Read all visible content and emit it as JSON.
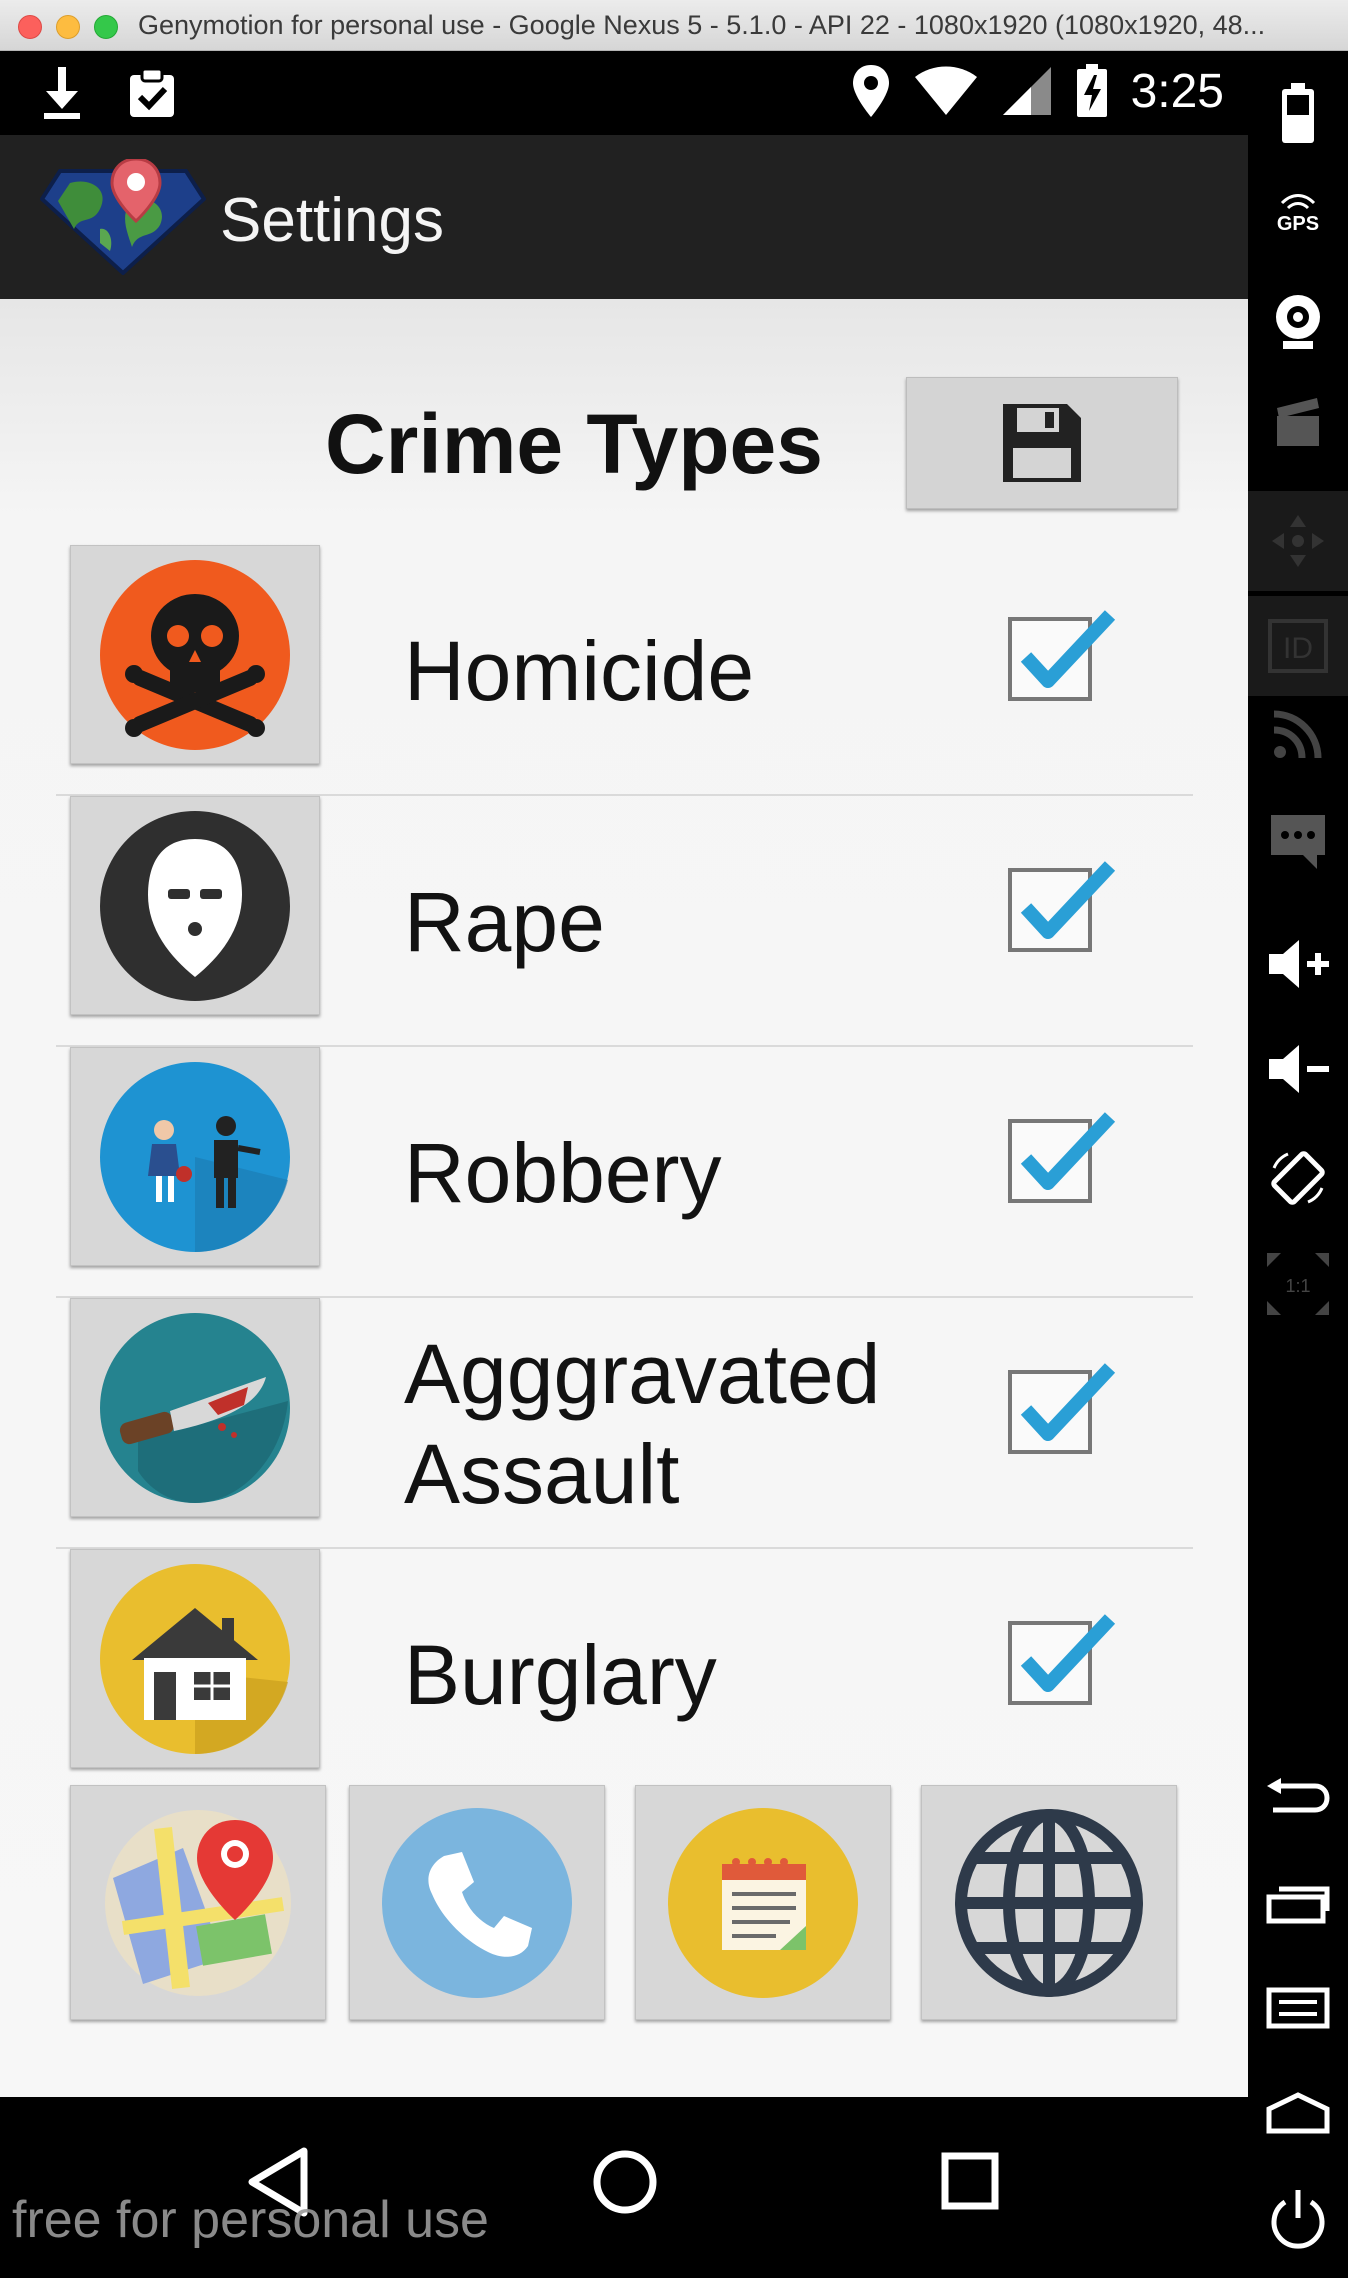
{
  "window": {
    "title": "Genymotion for personal use - Google Nexus 5 - 5.1.0 - API 22 - 1080x1920 (1080x1920, 48..."
  },
  "status_bar": {
    "time": "3:25",
    "icons_left": [
      "download-icon",
      "clipboard-check-icon"
    ],
    "icons_right": [
      "location-icon",
      "wifi-icon",
      "signal-icon",
      "battery-charging-icon"
    ]
  },
  "app_bar": {
    "title": "Settings",
    "logo": "crime-map-logo"
  },
  "main": {
    "heading": "Crime Types",
    "save_icon": "floppy-disk-icon",
    "crime_types": [
      {
        "label": "Homicide",
        "icon": "skull-crossbones-icon",
        "checked": true,
        "color": "#f05a1e"
      },
      {
        "label": "Rape",
        "icon": "masked-face-icon",
        "checked": true,
        "color": "#2f2f2f"
      },
      {
        "label": "Robbery",
        "icon": "robbery-icon",
        "checked": true,
        "color": "#1e93d2"
      },
      {
        "label": "Agggravated Assault",
        "icon": "bloody-knife-icon",
        "checked": true,
        "color": "#25838f"
      },
      {
        "label": "Burglary",
        "icon": "house-icon",
        "checked": true,
        "color": "#e9be2e"
      }
    ],
    "bottom_buttons": [
      {
        "name": "map-button",
        "icon": "map-pin-icon"
      },
      {
        "name": "phone-button",
        "icon": "phone-icon"
      },
      {
        "name": "notes-button",
        "icon": "notepad-icon"
      },
      {
        "name": "web-button",
        "icon": "globe-icon"
      }
    ]
  },
  "nav_bar": {
    "buttons": [
      "back-icon",
      "home-icon",
      "recents-icon"
    ]
  },
  "watermark": "free for personal use",
  "emulator_sidebar": {
    "tools": [
      "battery-icon",
      "gps-icon",
      "webcam-icon",
      "screencast-icon",
      "dpad-icon",
      "device-id-icon",
      "network-icon",
      "sms-icon",
      "volume-up-icon",
      "volume-down-icon",
      "rotate-icon",
      "scale-icon",
      "back-icon",
      "recent-apps-icon",
      "menu-icon",
      "home-icon",
      "power-icon"
    ],
    "gps_label": "GPS",
    "id_label": "ID",
    "scale_label": "1:1"
  },
  "colors": {
    "check_blue": "#2a9fd6",
    "app_bar": "#212121",
    "button_grey": "#d7d7d7"
  }
}
